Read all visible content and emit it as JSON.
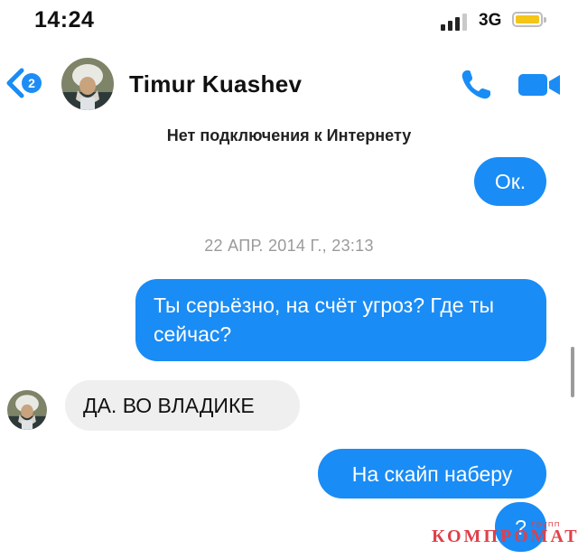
{
  "status_bar": {
    "time": "14:24",
    "network": "3G",
    "signal_bars_active": 3,
    "battery_color": "#f5c518"
  },
  "header": {
    "back_icon": "chevron-left-icon",
    "unread_badge": "2",
    "avatar_icon": "contact-avatar",
    "contact_name": "Timur  Kuashev",
    "call_icon": "phone-icon",
    "video_icon": "video-camera-icon",
    "accent_color": "#1a8cf5"
  },
  "offline_banner": "Нет подключения к Интернету",
  "conversation": {
    "timestamp": "22 АПР. 2014 Г., 23:13",
    "messages": [
      {
        "direction": "outgoing",
        "text": "Ок."
      },
      {
        "direction": "outgoing",
        "text": "Ты серьёзно, на счёт угроз? Где ты сейчас?"
      },
      {
        "direction": "incoming",
        "text": "ДА. ВО ВЛАДИКЕ"
      },
      {
        "direction": "outgoing",
        "text": "На скайп наберу"
      },
      {
        "direction": "outgoing",
        "text": "?"
      }
    ]
  },
  "watermark": {
    "superscript": "групп",
    "text": "КОМПРОМАТ"
  }
}
